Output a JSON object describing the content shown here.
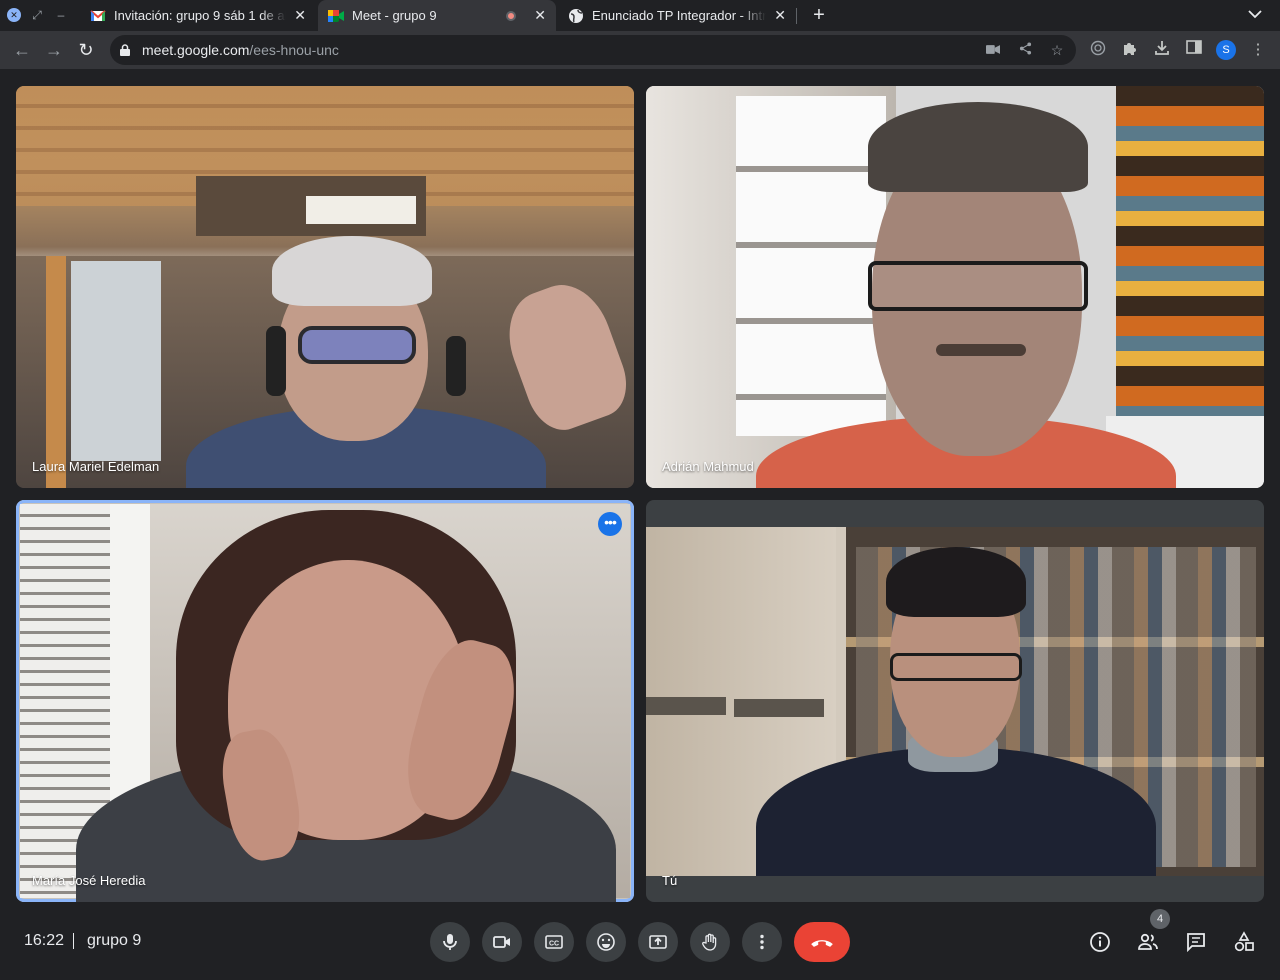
{
  "browser": {
    "tabs": [
      {
        "title": "Invitación: grupo 9 sáb 1 de ab",
        "favicon": "gmail-icon"
      },
      {
        "title": "Meet - grupo 9",
        "favicon": "meet-icon",
        "active": true,
        "recording": true
      },
      {
        "title": "Enunciado TP Integrador - Intr",
        "favicon": "globe-icon"
      }
    ],
    "url_host": "meet.google.com",
    "url_path": "/ees-hnou-unc",
    "profile_initial": "S"
  },
  "participants": [
    {
      "name": "Laura Mariel Edelman"
    },
    {
      "name": "Adrián Mahmud"
    },
    {
      "name": "María José Heredia",
      "speaking": true
    },
    {
      "name": "Tú"
    }
  ],
  "bottom_bar": {
    "time": "16:22",
    "meeting_name": "grupo 9",
    "participant_count": "4"
  },
  "colors": {
    "accent": "#8ab4f8",
    "end_call": "#ea4335",
    "background": "#202124"
  }
}
